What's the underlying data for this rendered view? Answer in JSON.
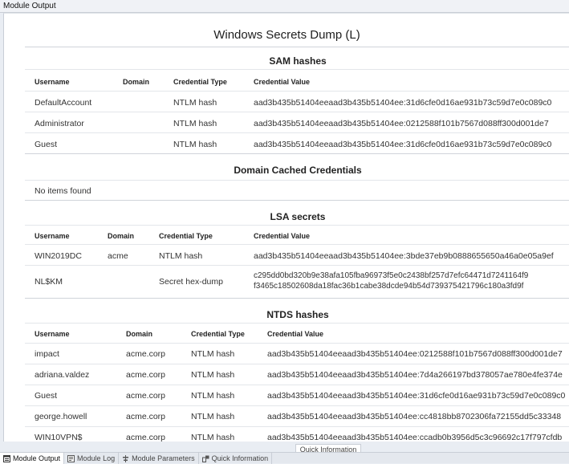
{
  "window": {
    "title": "Module Output"
  },
  "report": {
    "title": "Windows Secrets Dump (L)"
  },
  "sam": {
    "title": "SAM hashes",
    "headers": [
      "Username",
      "Domain",
      "Credential Type",
      "Credential Value"
    ],
    "rows": [
      {
        "user": "DefaultAccount",
        "domain": "",
        "type": "NTLM hash",
        "value": "aad3b435b51404eeaad3b435b51404ee:31d6cfe0d16ae931b73c59d7e0c089c0"
      },
      {
        "user": "Administrator",
        "domain": "",
        "type": "NTLM hash",
        "value": "aad3b435b51404eeaad3b435b51404ee:0212588f101b7567d088ff300d001de7"
      },
      {
        "user": "Guest",
        "domain": "",
        "type": "NTLM hash",
        "value": "aad3b435b51404eeaad3b435b51404ee:31d6cfe0d16ae931b73c59d7e0c089c0"
      }
    ]
  },
  "cached": {
    "title": "Domain Cached Credentials",
    "empty": "No items found"
  },
  "lsa": {
    "title": "LSA secrets",
    "headers": [
      "Username",
      "Domain",
      "Credential Type",
      "Credential Value"
    ],
    "rows": [
      {
        "user": "WIN2019DC",
        "domain": "acme",
        "type": "NTLM hash",
        "value": "aad3b435b51404eeaad3b435b51404ee:3bde37eb9b0888655650a46a0e05a9ef"
      },
      {
        "user": "NL$KM",
        "domain": "",
        "type": "Secret hex-dump",
        "value_line1": "c295dd0bd320b9e38afa105fba96973f5e0c2438bf257d7efc64471d7241164f9",
        "value_line2": "f3465c18502608da18fac36b1cabe38dcde94b54d739375421796c180a3fd9f"
      }
    ]
  },
  "ntds": {
    "title": "NTDS hashes",
    "headers": [
      "Username",
      "Domain",
      "Credential Type",
      "Credential Value"
    ],
    "rows": [
      {
        "user": "impact",
        "domain": "acme.corp",
        "type": "NTLM hash",
        "value": "aad3b435b51404eeaad3b435b51404ee:0212588f101b7567d088ff300d001de7"
      },
      {
        "user": "adriana.valdez",
        "domain": "acme.corp",
        "type": "NTLM hash",
        "value": "aad3b435b51404eeaad3b435b51404ee:7d4a266197bd378057ae780e4fe374e"
      },
      {
        "user": "Guest",
        "domain": "acme.corp",
        "type": "NTLM hash",
        "value": "aad3b435b51404eeaad3b435b51404ee:31d6cfe0d16ae931b73c59d7e0c089c0"
      },
      {
        "user": "george.howell",
        "domain": "acme.corp",
        "type": "NTLM hash",
        "value": "aad3b435b51404eeaad3b435b51404ee:cc4818bb8702306fa72155dd5c33348"
      },
      {
        "user": "WIN10VPN$",
        "domain": "acme.corp",
        "type": "NTLM hash",
        "value": "aad3b435b51404eeaad3b435b51404ee:ccadb0b3956d5c3c96692c17f797cfdb"
      }
    ]
  },
  "quick_info_label": "Quick Information",
  "tabs": [
    {
      "label": "Module Output",
      "icon": "module-output-icon",
      "active": true
    },
    {
      "label": "Module Log",
      "icon": "module-log-icon",
      "active": false
    },
    {
      "label": "Module Parameters",
      "icon": "module-parameters-icon",
      "active": false
    },
    {
      "label": "Quick Information",
      "icon": "quick-information-icon",
      "active": false
    }
  ]
}
